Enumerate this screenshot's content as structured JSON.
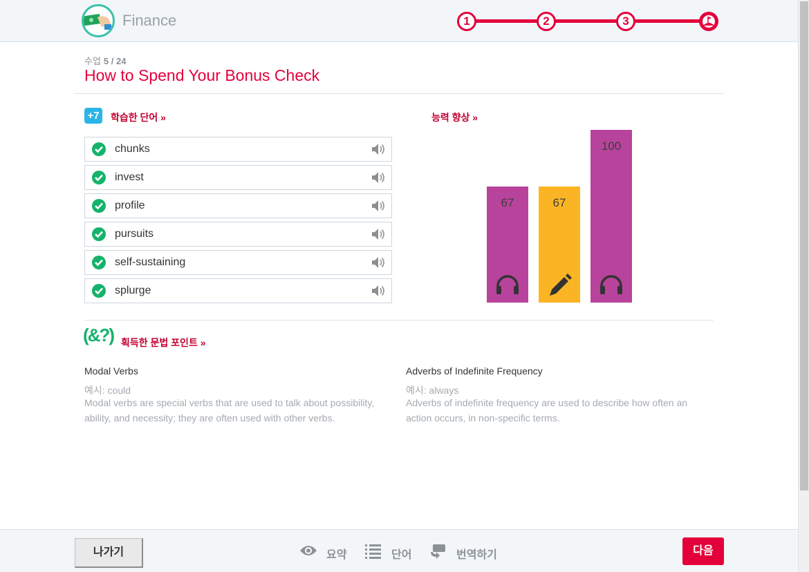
{
  "header": {
    "title": "Finance",
    "steps": [
      "1",
      "2",
      "3"
    ]
  },
  "lesson": {
    "label": "수업",
    "progress": "5 / 24",
    "title": "How to Spend Your Bonus Check"
  },
  "words_section": {
    "badge": "+7",
    "label": "학습한 단어 »",
    "words": [
      "chunks",
      "invest",
      "profile",
      "pursuits",
      "self-sustaining",
      "splurge"
    ]
  },
  "skills_section": {
    "label": "능력 향상 »"
  },
  "chart_data": {
    "type": "bar",
    "categories": [
      "headphones-icon",
      "pencil-icon",
      "headphones-icon"
    ],
    "values": [
      67,
      67,
      100
    ],
    "colors": [
      "#b8439c",
      "#fbb524",
      "#b8439c"
    ],
    "value_labels": [
      "67",
      "67",
      "100"
    ],
    "ylim": [
      0,
      100
    ],
    "title": "",
    "xlabel": "",
    "ylabel": "",
    "grid": false
  },
  "grammar_section": {
    "label": "획득한 문법 포인트 »",
    "icon_text": "(&?)",
    "points": [
      {
        "title": "Modal Verbs",
        "example": "예시: could",
        "description": "Modal verbs are special verbs that are used to talk about possibility, ability, and necessity; they are often used with other verbs."
      },
      {
        "title": "Adverbs of Indefinite Frequency",
        "example": "예시: always",
        "description": "Adverbs of indefinite frequency are used to describe how often an action occurs, in non-specific terms."
      }
    ]
  },
  "footer": {
    "exit_label": "나가기",
    "summary_label": "요약",
    "words_label": "단어",
    "translate_label": "번역하기",
    "next_label": "다음"
  },
  "colors": {
    "accent": "#e4003a",
    "check": "#14b36b",
    "badge": "#2bb5e6"
  }
}
